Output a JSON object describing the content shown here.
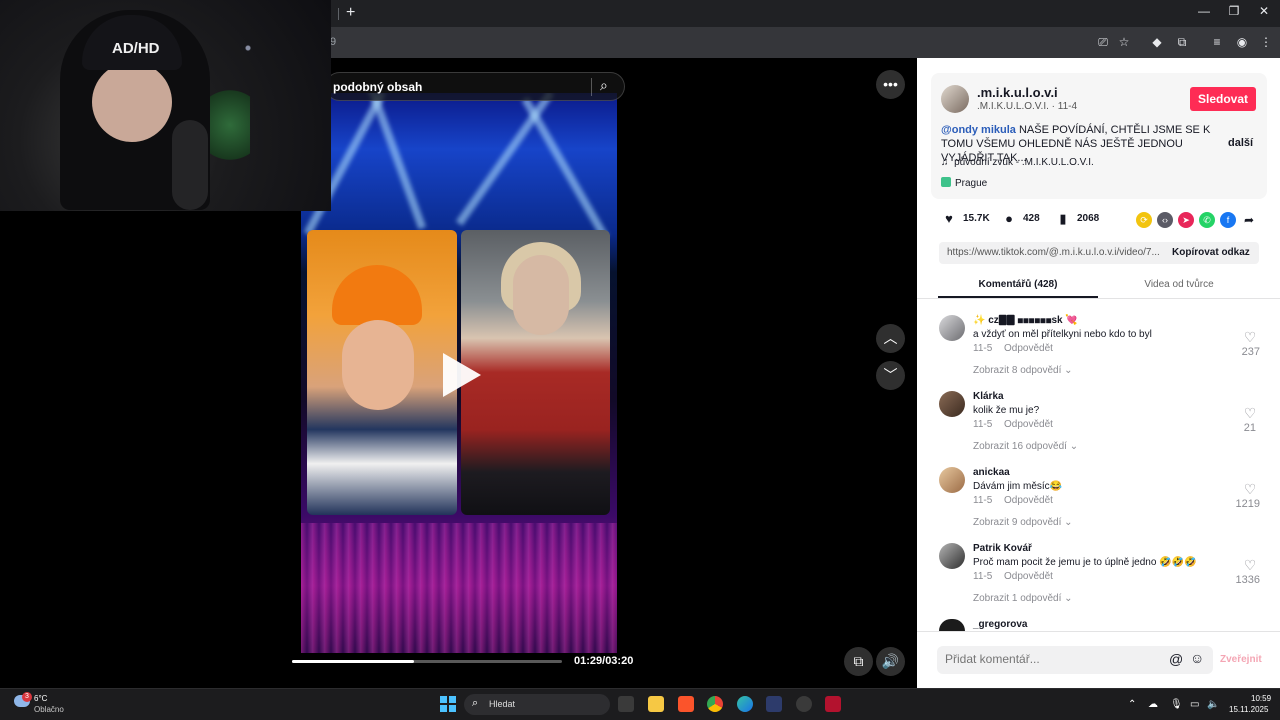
{
  "browser": {
    "url_fragment": "9",
    "new_tab_label": "+"
  },
  "video": {
    "search_text": "podobný obsah",
    "duet_left_hood_text": "",
    "time": "01:29/03:20",
    "progress": 0.45
  },
  "webcam": {
    "beanie_text": "AD/HD"
  },
  "post": {
    "author": ".m.i.k.u.l.o.v.i",
    "author_sub": ".M.I.K.U.L.O.V.I. · 11-4",
    "follow_label": "Sledovat",
    "mention": "@ondy mikula",
    "description": " NAŠE POVÍDÁNÍ, CHTĚLI JSME SE K TOMU VŠEMU OHLEDNĚ NÁS JEŠTĚ JEDNOU VYJÁDŘIT TAK...",
    "more_label": "další",
    "sound": "původní zvuk - .M.I.K.U.L.O.V.I.",
    "location": "Prague",
    "likes": "15.7K",
    "comments": "428",
    "saves": "2068",
    "link": "https://www.tiktok.com/@.m.i.k.u.l.o.v.i/video/7...",
    "copy_label": "Kopírovat odkaz"
  },
  "tabs": {
    "comments": "Komentářů (428)",
    "creator_videos": "Videa od tvůrce"
  },
  "comments": [
    {
      "name": "✨ cz🀫🀫 ◼◼◼◼◼◼sk 💘",
      "text": "a vždyť on měl přítelkyni nebo kdo to byl",
      "date": "11-5",
      "reply": "Odpovědět",
      "replies": "Zobrazit 8 odpovědí",
      "likes": "237"
    },
    {
      "name": "Klárka",
      "text": "kolik že mu je?",
      "date": "11-5",
      "reply": "Odpovědět",
      "replies": "Zobrazit 16 odpovědí",
      "likes": "21"
    },
    {
      "name": "anickaa",
      "text": "Dávám jim měsíc😂",
      "date": "11-5",
      "reply": "Odpovědět",
      "replies": "Zobrazit 9 odpovědí",
      "likes": "1219"
    },
    {
      "name": "Patrik Kovář",
      "text": "Proč mam pocit že jemu je to úplně jedno 🤣🤣🤣",
      "date": "11-5",
      "reply": "Odpovědět",
      "replies": "Zobrazit 1 odpovědí",
      "likes": "1336"
    },
    {
      "name": "_gregorova"
    }
  ],
  "comment_input": {
    "placeholder": "Přidat komentář...",
    "post_label": "Zveřejnit"
  },
  "taskbar": {
    "weather_temp": "6°C",
    "weather_desc": "Oblačno",
    "weather_badge": "3",
    "search_label": "Hledat",
    "time": "10:59",
    "date": "15.11.2025"
  },
  "colors": {
    "follow": "#fe2c55",
    "mention": "#2b5db9",
    "windows_blue": "#4cc2ff"
  }
}
